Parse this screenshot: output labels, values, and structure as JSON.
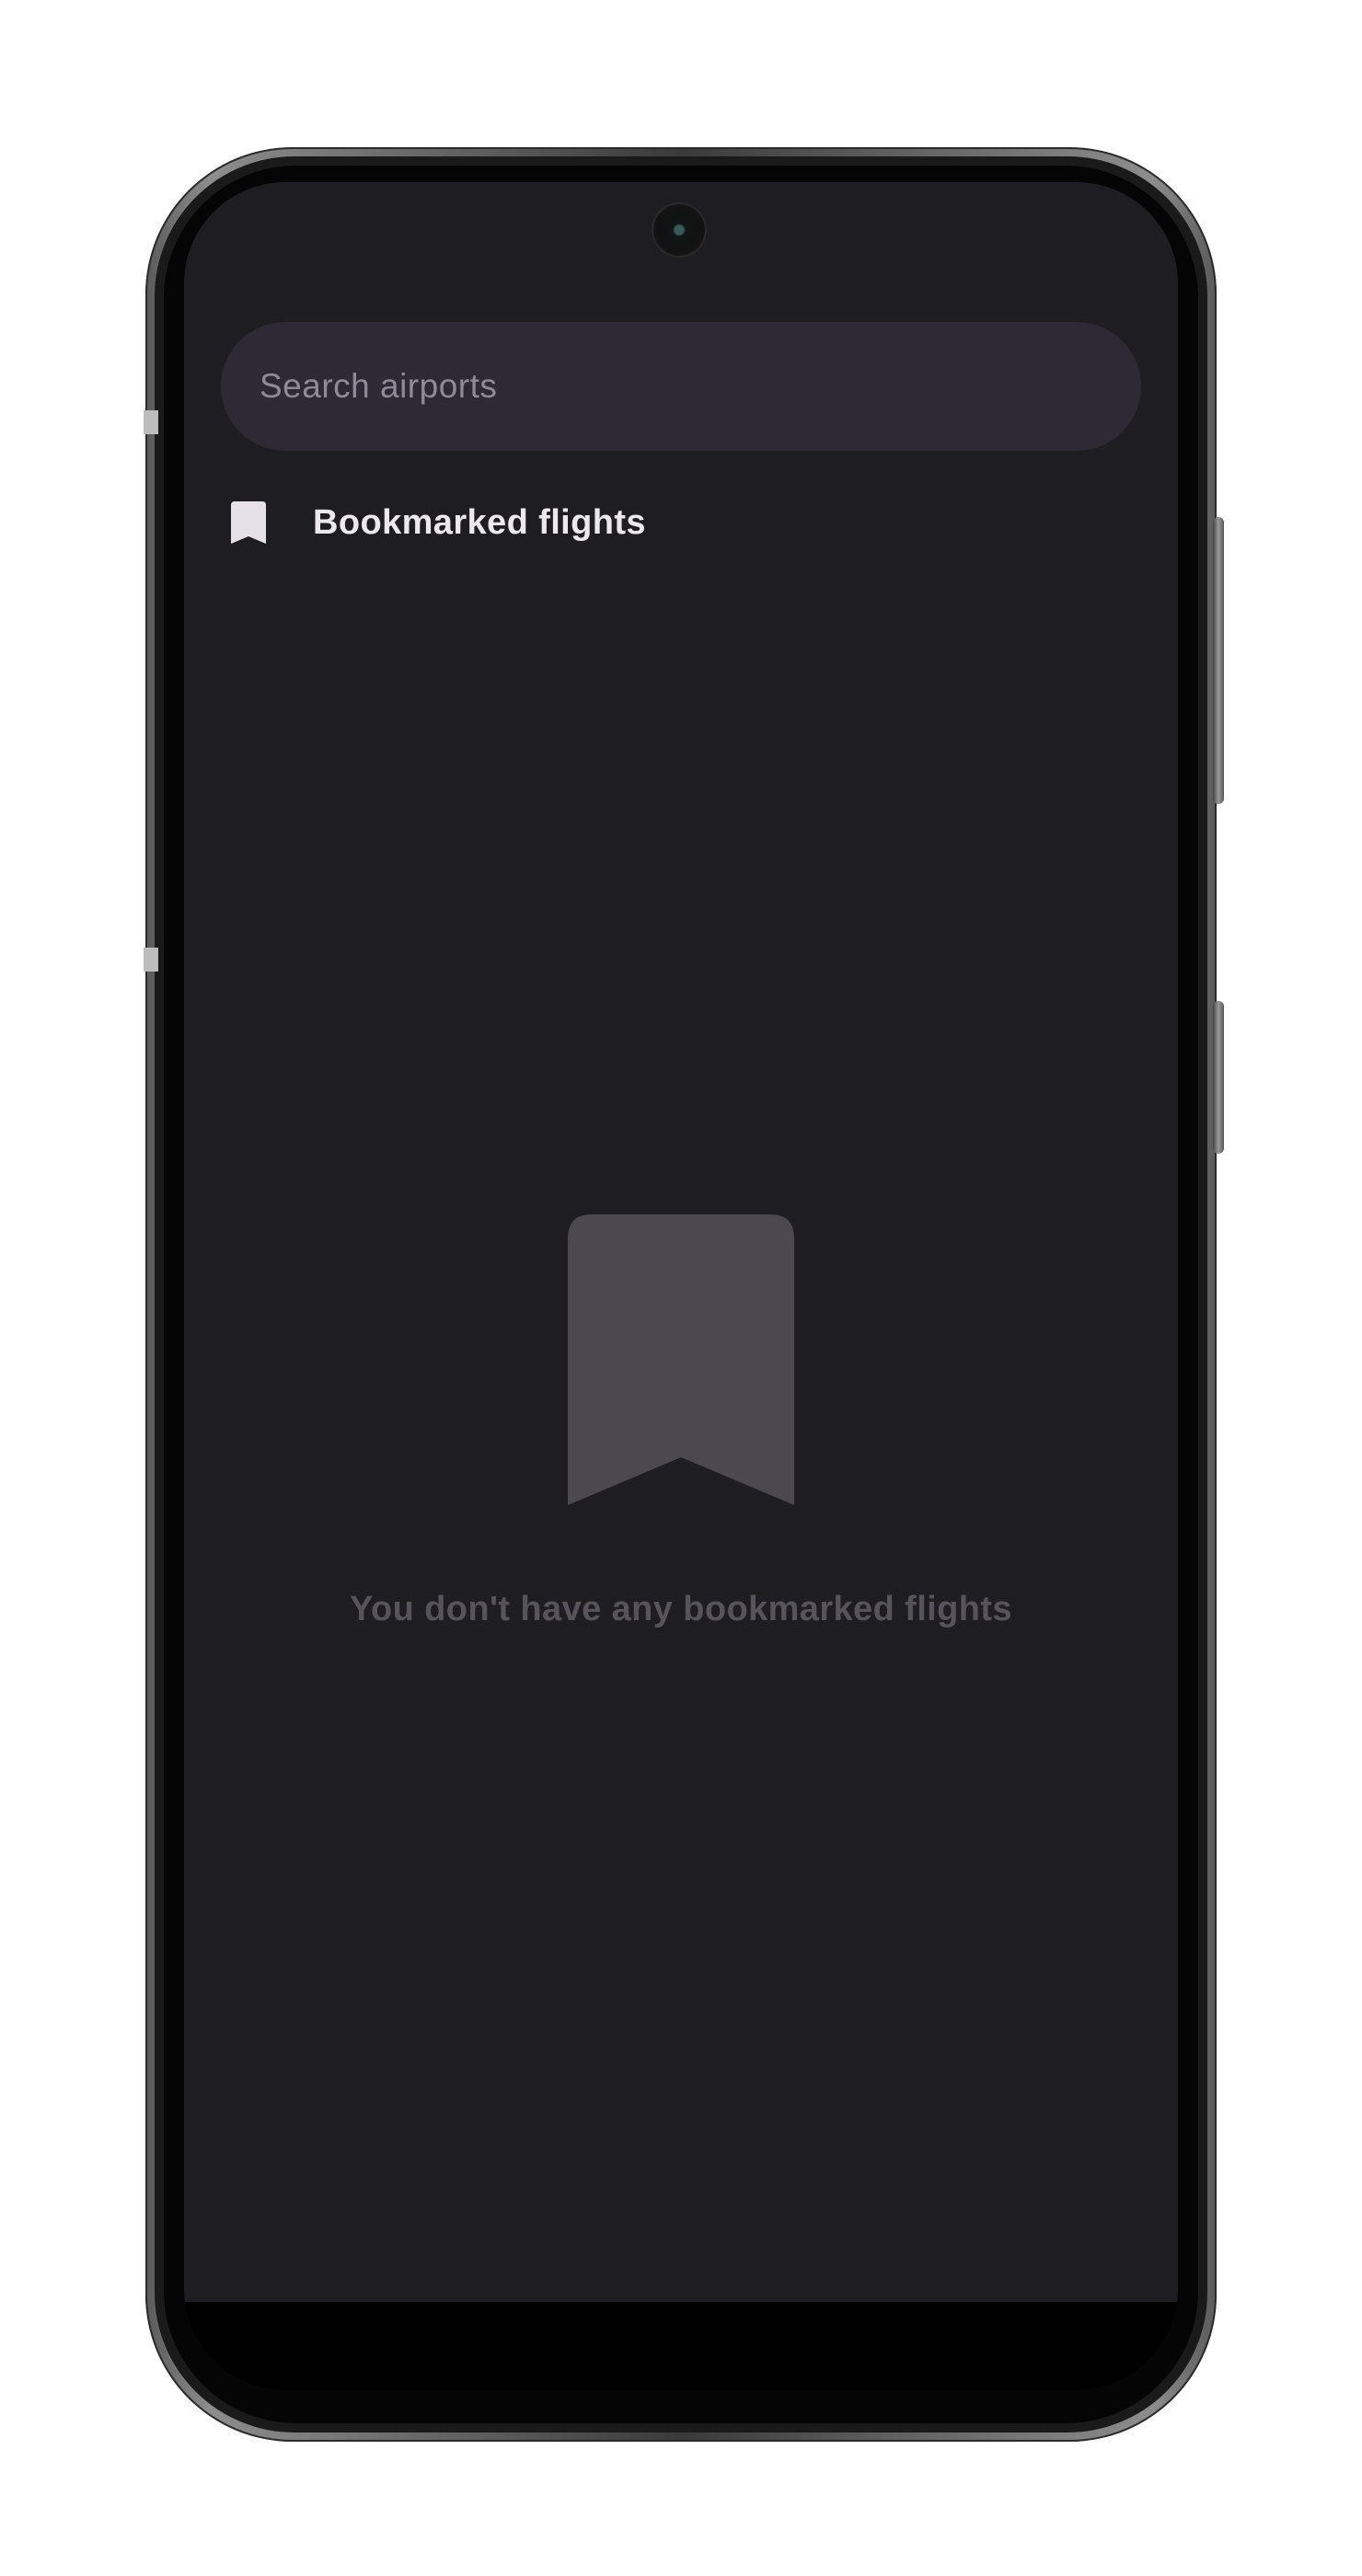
{
  "search": {
    "placeholder": "Search airports",
    "value": ""
  },
  "bookmarks": {
    "header_label": "Bookmarked flights",
    "header_icon": "bookmark-icon"
  },
  "empty_state": {
    "icon": "bookmark-icon",
    "message": "You don't have any bookmarked flights"
  },
  "colors": {
    "screen_background": "#1e1e22",
    "search_background": "#2d2a35",
    "placeholder_text": "#8f8a97",
    "primary_text": "#ebe8ee",
    "empty_icon": "#4b494f",
    "empty_text": "#56535a"
  }
}
